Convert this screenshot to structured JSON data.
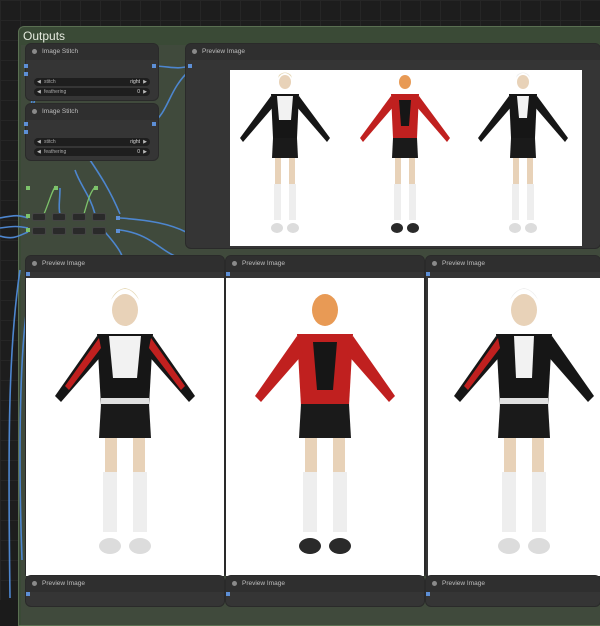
{
  "group": {
    "title": "Outputs"
  },
  "stitch_nodes": [
    {
      "title": "Image Stitch",
      "widgets": [
        {
          "label": "stitch",
          "value": "right"
        },
        {
          "label": "feathering",
          "value": "0"
        }
      ]
    },
    {
      "title": "Image Stitch",
      "widgets": [
        {
          "label": "stitch",
          "value": "right"
        },
        {
          "label": "feathering",
          "value": "0"
        }
      ]
    }
  ],
  "preview_nodes": {
    "top": {
      "title": "Preview Image"
    },
    "middle": [
      {
        "title": "Preview Image"
      },
      {
        "title": "Preview Image"
      },
      {
        "title": "Preview Image"
      }
    ],
    "bottom": [
      {
        "title": "Preview Image"
      },
      {
        "title": "Preview Image"
      },
      {
        "title": "Preview Image"
      }
    ]
  },
  "colors": {
    "jacket_red": "#c0201f",
    "jacket_black": "#161616",
    "wire_blue": "#4d86cf",
    "group_green": "#3a4a36"
  }
}
